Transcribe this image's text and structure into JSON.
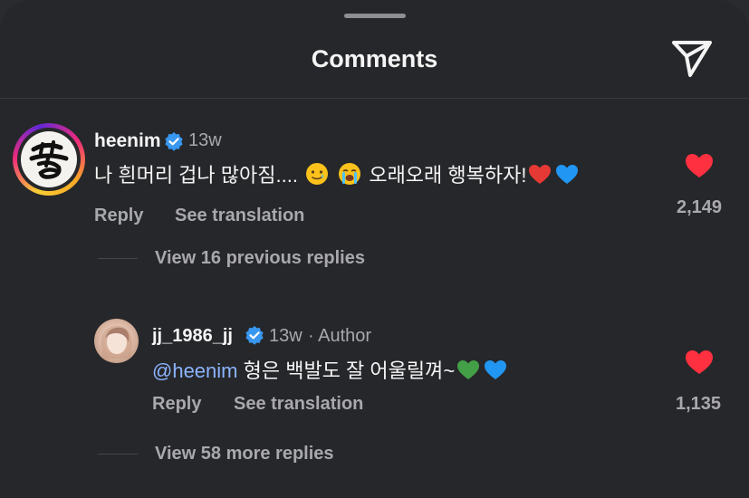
{
  "header": {
    "title": "Comments",
    "send_icon": "paper-plane-icon"
  },
  "comments": [
    {
      "username": "heenim",
      "verified": true,
      "time": "13w",
      "text_before": "나 흰머리 겁나 많아짐....",
      "text_after": "오래오래 행복하자!",
      "emojis": [
        "smiling-face-with-tear",
        "loudly-crying-face",
        "red-heart",
        "blue-heart"
      ],
      "reply_label": "Reply",
      "translate_label": "See translation",
      "likes": "2,149",
      "liked": true,
      "heart_color": "#ff3040",
      "view_replies_label": "View 16 previous replies"
    },
    {
      "username": "jj_1986_jj",
      "verified": true,
      "time": "13w",
      "author_label": "· Author",
      "mention": "@heenim",
      "text": "형은 백발도 잘 어울릴껴~",
      "emojis": [
        "green-heart",
        "blue-heart"
      ],
      "reply_label": "Reply",
      "translate_label": "See translation",
      "likes": "1,135",
      "liked": true,
      "heart_color": "#ff3040",
      "view_replies_label": "View 58 more replies"
    }
  ],
  "colors": {
    "background": "#26272a",
    "text": "#f5f5f5",
    "secondary_text": "#a8a8ad",
    "mention": "#8cb4ff",
    "verified_badge": "#3897f0",
    "like_heart": "#ff3040"
  }
}
